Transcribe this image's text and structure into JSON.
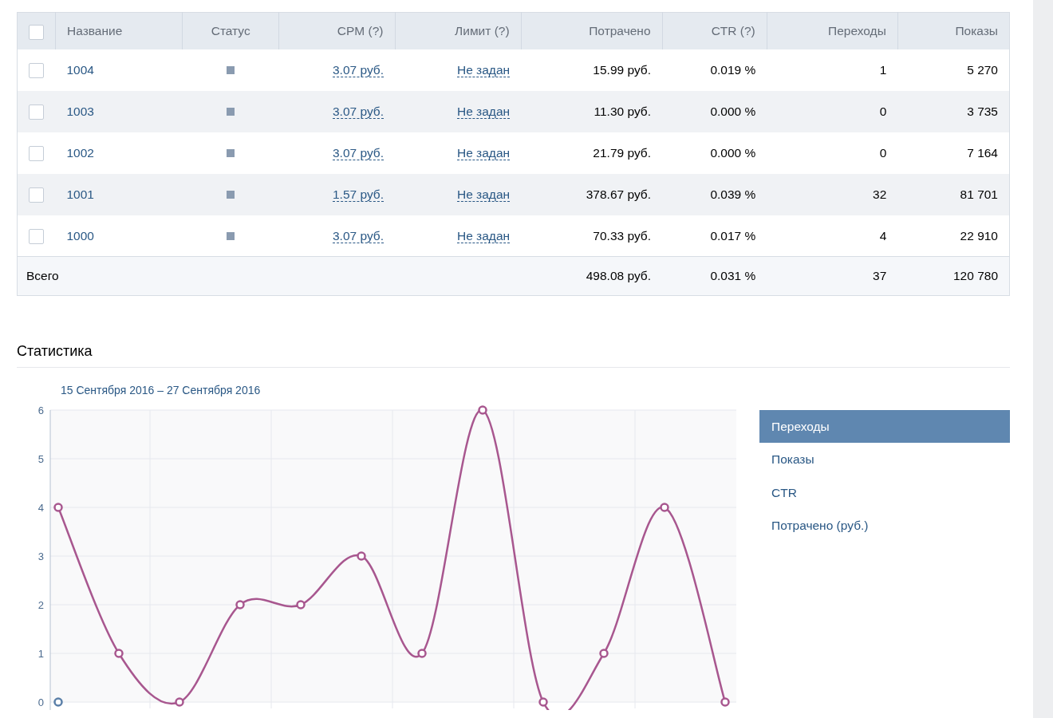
{
  "table": {
    "select_all_checked": false,
    "columns": [
      "Название",
      "Статус",
      "CPM (?)",
      "Лимит (?)",
      "Потрачено",
      "CTR (?)",
      "Переходы",
      "Показы"
    ],
    "rows": [
      {
        "checked": false,
        "name": "1004",
        "cpm": "3.07 руб.",
        "limit": "Не задан",
        "spent": "15.99 руб.",
        "ctr": "0.019 %",
        "clicks": "1",
        "impressions": "5 270"
      },
      {
        "checked": false,
        "name": "1003",
        "cpm": "3.07 руб.",
        "limit": "Не задан",
        "spent": "11.30 руб.",
        "ctr": "0.000 %",
        "clicks": "0",
        "impressions": "3 735"
      },
      {
        "checked": false,
        "name": "1002",
        "cpm": "3.07 руб.",
        "limit": "Не задан",
        "spent": "21.79 руб.",
        "ctr": "0.000 %",
        "clicks": "0",
        "impressions": "7 164"
      },
      {
        "checked": false,
        "name": "1001",
        "cpm": "1.57 руб.",
        "limit": "Не задан",
        "spent": "378.67 руб.",
        "ctr": "0.039 %",
        "clicks": "32",
        "impressions": "81 701"
      },
      {
        "checked": false,
        "name": "1000",
        "cpm": "3.07 руб.",
        "limit": "Не задан",
        "spent": "70.33 руб.",
        "ctr": "0.017 %",
        "clicks": "4",
        "impressions": "22 910"
      }
    ],
    "total": {
      "label": "Всего",
      "spent": "498.08 руб.",
      "ctr": "0.031 %",
      "clicks": "37",
      "impressions": "120 780"
    }
  },
  "statistics": {
    "title": "Статистика",
    "date_range": "15 Сентября 2016 – 27 Сентября 2016",
    "chart_data": {
      "type": "line",
      "grid": true,
      "ylim": [
        0,
        6
      ],
      "yticks": [
        0,
        1,
        2,
        3,
        4,
        5,
        6
      ],
      "series": [
        {
          "color": "#a8578f",
          "marker": "circle",
          "values": [
            4,
            1,
            0,
            2,
            2,
            3,
            1,
            6,
            0,
            1,
            4,
            0
          ]
        },
        {
          "color": "#5a7fa8",
          "marker": "circle",
          "values": [
            0,
            null,
            null,
            null,
            null,
            null,
            null,
            null,
            null,
            null,
            null,
            null
          ]
        }
      ]
    },
    "metrics": [
      {
        "label": "Переходы",
        "selected": true
      },
      {
        "label": "Показы",
        "selected": false
      },
      {
        "label": "CTR",
        "selected": false
      },
      {
        "label": "Потрачено (руб.)",
        "selected": false
      }
    ]
  }
}
